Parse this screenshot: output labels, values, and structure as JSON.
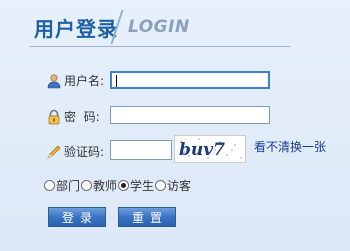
{
  "header": {
    "title": "用户登录",
    "title_en": "LOGIN"
  },
  "form": {
    "username": {
      "label": "用户名:",
      "value": ""
    },
    "password": {
      "label": "密  码:",
      "value": ""
    },
    "captcha": {
      "label": "验证码:",
      "value": "",
      "image_text": "buv7",
      "refresh_label": "看不清换一张"
    }
  },
  "roles": {
    "options": [
      "部门",
      "教师",
      "学生",
      "访客"
    ],
    "selected": "学生"
  },
  "buttons": {
    "login": "登录",
    "reset": "重置"
  },
  "colors": {
    "title": "#1f5fa8",
    "button": "#3b74c4",
    "link": "#1a3c8f"
  }
}
